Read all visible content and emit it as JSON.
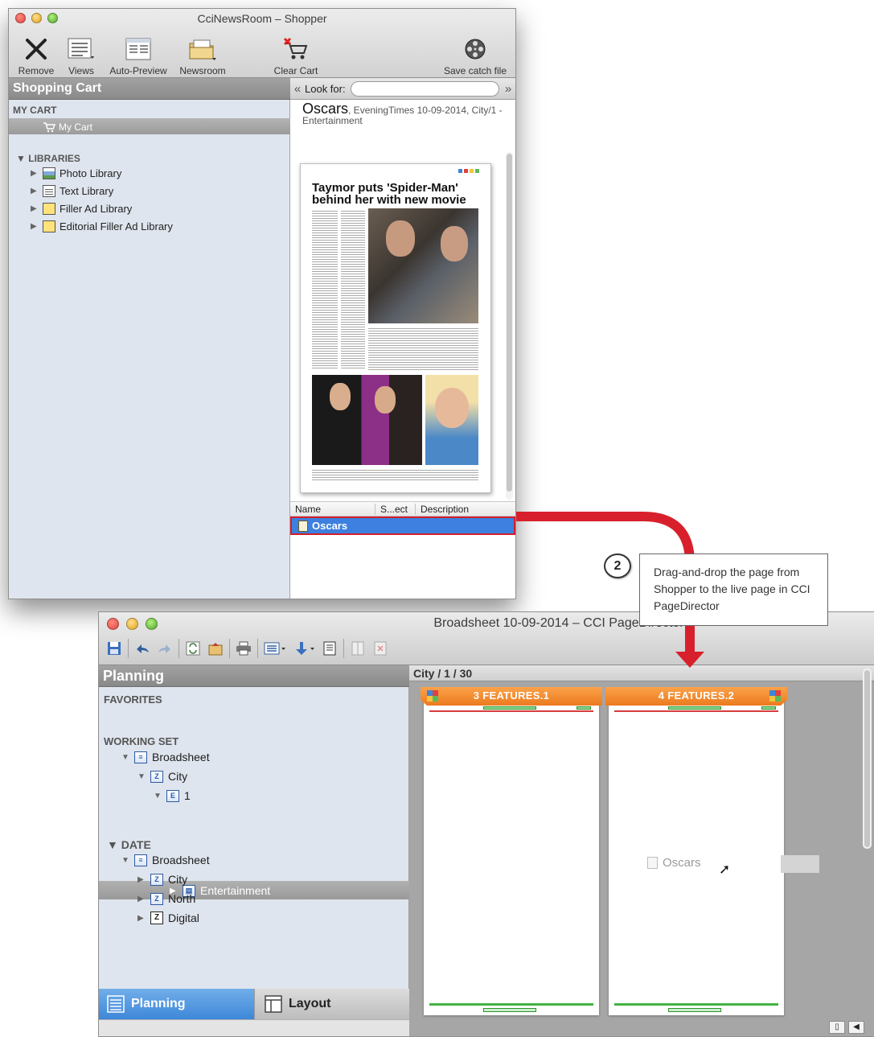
{
  "shopper": {
    "title": "CciNewsRoom – Shopper",
    "toolbar": {
      "remove": "Remove",
      "views": "Views",
      "auto_preview": "Auto-Preview",
      "newsroom": "Newsroom",
      "clear_cart": "Clear Cart",
      "save_catch": "Save catch file"
    },
    "sidebar": {
      "header": "Shopping Cart",
      "my_cart_section": "MY CART",
      "my_cart_item": "My Cart",
      "libraries_section": "LIBRARIES",
      "libraries": [
        "Photo Library",
        "Text Library",
        "Filler Ad Library",
        "Editorial Filler Ad Library"
      ]
    },
    "search": {
      "label": "Look for:",
      "value": ""
    },
    "preview": {
      "name": "Oscars",
      "meta": ", EveningTimes 10-09-2014, City/1 -",
      "section": "Entertainment",
      "headline": "Taymor puts 'Spider-Man' behind her with new movie"
    },
    "list": {
      "columns": [
        "Name",
        "S...ect",
        "Description"
      ],
      "rows": [
        "Oscars"
      ]
    }
  },
  "callout": {
    "step": "2",
    "text": "Drag-and-drop the page from Shopper to the live page in CCI PageDirector"
  },
  "pagedirector": {
    "title": "Broadsheet 10-09-2014 – CCI PageDirector",
    "sidebar": {
      "header": "Planning",
      "favorites": "FAVORITES",
      "working_set": "WORKING SET",
      "ws_broadsheet": "Broadsheet",
      "ws_city": "City",
      "ws_page": "1",
      "ws_section": "Entertainment",
      "date": "DATE",
      "date_broadsheet": "Broadsheet",
      "date_items": [
        "City",
        "North",
        "Digital"
      ]
    },
    "tabs": {
      "planning": "Planning",
      "layout": "Layout"
    },
    "breadcrumb": "City / 1 / 30",
    "pages": [
      "3 FEATURES.1",
      "4 FEATURES.2"
    ],
    "drop_label": "Oscars"
  }
}
